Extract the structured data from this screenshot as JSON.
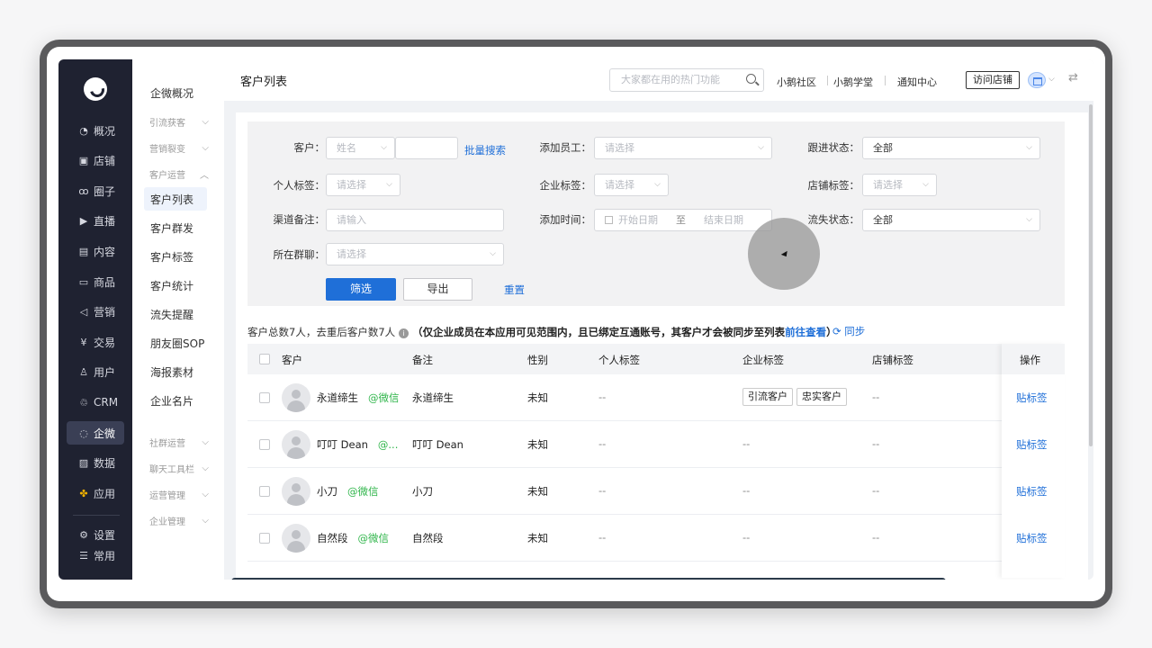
{
  "rail": {
    "items": [
      {
        "icon": "pie-chart-icon",
        "glyph": "◔",
        "label": "概况"
      },
      {
        "icon": "store-icon",
        "glyph": "▣",
        "label": "店铺"
      },
      {
        "icon": "circle-icon",
        "glyph": "ꝏ",
        "label": "圈子"
      },
      {
        "icon": "live-icon",
        "glyph": "▶",
        "label": "直播"
      },
      {
        "icon": "content-icon",
        "glyph": "▤",
        "label": "内容"
      },
      {
        "icon": "goods-icon",
        "glyph": "▭",
        "label": "商品"
      },
      {
        "icon": "marketing-icon",
        "glyph": "◁",
        "label": "营销"
      },
      {
        "icon": "trade-icon",
        "glyph": "¥",
        "label": "交易"
      },
      {
        "icon": "user-icon",
        "glyph": "♙",
        "label": "用户"
      },
      {
        "icon": "crm-icon",
        "glyph": "♲",
        "label": "CRM"
      },
      {
        "icon": "wecom-icon",
        "glyph": "◌",
        "label": "企微"
      },
      {
        "icon": "data-icon",
        "glyph": "▨",
        "label": "数据"
      },
      {
        "icon": "apps-icon",
        "glyph": "✤",
        "label": "应用"
      },
      {
        "icon": "settings-icon",
        "glyph": "⚙",
        "label": "设置"
      },
      {
        "icon": "common-icon",
        "glyph": "☰",
        "label": "常用"
      }
    ]
  },
  "subnav": {
    "overview": "企微概况",
    "group_traffic": "引流获客",
    "group_fission": "营销裂变",
    "group_ops": "客户运营",
    "items": [
      "客户列表",
      "客户群发",
      "客户标签",
      "客户统计",
      "流失提醒",
      "朋友圈SOP",
      "海报素材",
      "企业名片"
    ],
    "group_community": "社群运营",
    "group_chat": "聊天工具栏",
    "group_operation": "运营管理",
    "group_enterprise": "企业管理"
  },
  "topbar": {
    "title": "客户列表",
    "search_placeholder": "大家都在用的热门功能",
    "links": [
      "小鹅社区",
      "小鹅学堂",
      "通知中心"
    ],
    "visit_store": "访问店铺"
  },
  "filters": {
    "customer_label": "客户：",
    "customer_type": "姓名",
    "batch_search": "批量搜索",
    "staff_label": "添加员工：",
    "staff_placeholder": "请选择",
    "follow_label": "跟进状态：",
    "follow_value": "全部",
    "personal_tag_label": "个人标签：",
    "personal_tag_placeholder": "请选择",
    "corp_tag_label": "企业标签：",
    "corp_tag_placeholder": "请选择",
    "store_tag_label": "店铺标签：",
    "store_tag_placeholder": "请选择",
    "channel_note_label": "渠道备注：",
    "channel_note_placeholder": "请输入",
    "add_time_label": "添加时间：",
    "start_date": "开始日期",
    "date_to": "至",
    "end_date": "结束日期",
    "churn_label": "流失状态：",
    "churn_value": "全部",
    "group_label": "所在群聊：",
    "group_placeholder": "请选择",
    "filter_btn": "筛选",
    "export_btn": "导出",
    "reset_btn": "重置"
  },
  "summary": {
    "counts": "客户总数7人，去重后客户数7人",
    "notice": "（仅企业成员在本应用可见范围内，且已绑定互通账号，其客户才会被同步至列表",
    "go_view": "前往查看",
    "close_paren": "）",
    "sync": "同步"
  },
  "table": {
    "headers": {
      "customer": "客户",
      "remark": "备注",
      "gender": "性别",
      "personal_tag": "个人标签",
      "corp_tag": "企业标签",
      "store_tag": "店铺标签",
      "action": "操作"
    },
    "rows": [
      {
        "name": "永道缔生",
        "source": "@微信",
        "remark": "永道缔生",
        "gender": "未知",
        "personal_tag": "--",
        "corp_tags": [
          "引流客户",
          "忠实客户"
        ],
        "store_tag": "--",
        "action": "贴标签"
      },
      {
        "name": "叮叮 Dean",
        "source": "@...",
        "remark": "叮叮 Dean",
        "gender": "未知",
        "personal_tag": "--",
        "corp_tag_text": "--",
        "store_tag": "--",
        "action": "贴标签"
      },
      {
        "name": "小刀",
        "source": "@微信",
        "remark": "小刀",
        "gender": "未知",
        "personal_tag": "--",
        "corp_tag_text": "--",
        "store_tag": "--",
        "action": "贴标签"
      },
      {
        "name": "自然段",
        "source": "@微信",
        "remark": "自然段",
        "gender": "未知",
        "personal_tag": "--",
        "corp_tag_text": "--",
        "store_tag": "--",
        "action": "贴标签"
      }
    ]
  }
}
